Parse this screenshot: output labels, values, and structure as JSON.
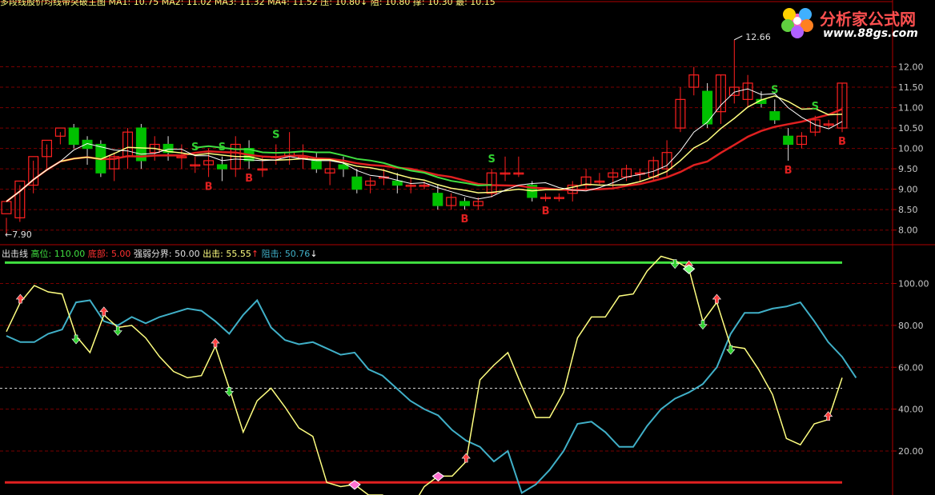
{
  "header": {
    "top_text": "多段线股价均线带突破主图  MA1: 10.75  MA2: 11.02  MA3: 11.32  MA4: 11.52  压: 10.80↓  阻: 10.80  撑: 10.30  最: 10.15"
  },
  "logo": {
    "title": "分析家公式网",
    "url": "www.88gs.com"
  },
  "indicator_legend": {
    "name": "出击线",
    "high_label": "高位:",
    "high_value": "110.00",
    "bottom_label": "底部:",
    "bottom_value": "5.00",
    "mid_label": "强弱分界:",
    "mid_value": "50.00",
    "strike_label": "出击:",
    "strike_value": "55.55",
    "strike_arrow": "↑",
    "resist_label": "阻击:",
    "resist_value": "50.76",
    "resist_arrow": "↓"
  },
  "colors": {
    "background": "#000000",
    "grid": "#7a0000",
    "axis_text": "#c8c8c8",
    "up_candle": "#ff2020",
    "down_candle": "#00c000",
    "ma_white": "#ffffff",
    "ma_red": "#e02020",
    "ma_yellow": "#ffff80",
    "ma_green": "#40e040",
    "strike_line": "#ffff80",
    "resist_line": "#40b0c8",
    "high_line": "#40e040",
    "bottom_line": "#e02020",
    "signal_s": "#30d030",
    "signal_b": "#e02020"
  },
  "chart_data": [
    {
      "type": "candlestick",
      "y_ticks": [
        "12.00",
        "11.50",
        "11.00",
        "10.50",
        "10.00",
        "9.50",
        "9.00",
        "8.50",
        "8.00"
      ],
      "ylim": [
        7.7,
        12.5
      ],
      "max_label": "12.66",
      "min_label": "7.90",
      "candles": [
        [
          8.4,
          8.7,
          7.9,
          8.3
        ],
        [
          8.3,
          9.2,
          8.2,
          9.1
        ],
        [
          9.1,
          9.8,
          8.9,
          9.7
        ],
        [
          9.8,
          10.2,
          9.5,
          10.1
        ],
        [
          10.3,
          10.5,
          10.1,
          10.4
        ],
        [
          10.5,
          10.1,
          10.0,
          10.6
        ],
        [
          10.2,
          10.0,
          9.6,
          10.3
        ],
        [
          10.1,
          9.4,
          9.3,
          10.2
        ],
        [
          9.5,
          9.8,
          9.2,
          9.9
        ],
        [
          9.8,
          10.4,
          9.5,
          10.5
        ],
        [
          10.5,
          9.7,
          9.5,
          10.6
        ],
        [
          9.9,
          10.1,
          9.7,
          10.3
        ],
        [
          10.1,
          9.9,
          9.7,
          10.3
        ],
        [
          9.8,
          9.8,
          9.5,
          10.1
        ],
        [
          9.6,
          9.6,
          9.4,
          9.8
        ],
        [
          9.6,
          9.7,
          9.3,
          10.0
        ],
        [
          9.6,
          9.5,
          9.2,
          9.8
        ],
        [
          9.5,
          10.1,
          9.3,
          10.3
        ],
        [
          10.0,
          9.7,
          9.5,
          10.2
        ],
        [
          9.5,
          9.5,
          9.3,
          9.8
        ],
        [
          9.8,
          9.8,
          9.6,
          10.1
        ],
        [
          9.8,
          9.9,
          9.6,
          10.4
        ],
        [
          9.8,
          9.8,
          9.5,
          10.1
        ],
        [
          9.7,
          9.5,
          9.4,
          9.9
        ],
        [
          9.4,
          9.5,
          9.1,
          9.7
        ],
        [
          9.6,
          9.5,
          9.3,
          9.8
        ],
        [
          9.3,
          9.0,
          8.9,
          9.5
        ],
        [
          9.1,
          9.2,
          8.9,
          9.3
        ],
        [
          9.3,
          9.3,
          9.1,
          9.5
        ],
        [
          9.2,
          9.1,
          8.9,
          9.4
        ],
        [
          9.1,
          9.1,
          8.9,
          9.3
        ],
        [
          9.1,
          9.1,
          9.0,
          9.2
        ],
        [
          8.9,
          8.6,
          8.5,
          9.1
        ],
        [
          8.6,
          8.8,
          8.5,
          8.9
        ],
        [
          8.7,
          8.6,
          8.5,
          8.8
        ],
        [
          8.6,
          8.7,
          8.5,
          8.8
        ],
        [
          8.9,
          9.4,
          8.8,
          9.5
        ],
        [
          9.4,
          9.4,
          9.2,
          9.8
        ],
        [
          9.4,
          9.4,
          9.3,
          9.8
        ],
        [
          9.1,
          8.8,
          8.7,
          9.2
        ],
        [
          8.8,
          8.8,
          8.7,
          8.9
        ],
        [
          8.8,
          8.8,
          8.7,
          8.9
        ],
        [
          8.9,
          9.1,
          8.7,
          9.2
        ],
        [
          9.1,
          9.3,
          9.0,
          9.5
        ],
        [
          9.2,
          9.2,
          9.1,
          9.4
        ],
        [
          9.3,
          9.4,
          9.0,
          9.5
        ],
        [
          9.3,
          9.5,
          9.2,
          9.6
        ],
        [
          9.4,
          9.4,
          9.2,
          9.5
        ],
        [
          9.3,
          9.7,
          9.2,
          9.8
        ],
        [
          9.5,
          9.9,
          9.3,
          10.2
        ],
        [
          10.5,
          11.2,
          10.4,
          11.5
        ],
        [
          11.5,
          11.8,
          11.3,
          12.0
        ],
        [
          11.4,
          10.6,
          10.5,
          11.6
        ],
        [
          10.9,
          11.8,
          10.6,
          11.8
        ],
        [
          11.3,
          11.5,
          11.1,
          12.66
        ],
        [
          11.2,
          11.6,
          11.0,
          11.8
        ],
        [
          11.2,
          11.1,
          11.0,
          11.4
        ],
        [
          10.9,
          10.7,
          10.6,
          11.2
        ],
        [
          10.3,
          10.1,
          9.7,
          10.5
        ],
        [
          10.1,
          10.3,
          10.0,
          10.4
        ],
        [
          10.4,
          10.7,
          10.3,
          10.8
        ],
        [
          10.6,
          10.6,
          10.5,
          10.7
        ],
        [
          10.5,
          11.6,
          10.4,
          11.6
        ]
      ],
      "signals": [
        {
          "i": 14,
          "text": "S"
        },
        {
          "i": 16,
          "text": "S"
        },
        {
          "i": 20,
          "text": "S"
        },
        {
          "i": 15,
          "text": "B"
        },
        {
          "i": 18,
          "text": "B"
        },
        {
          "i": 36,
          "text": "S"
        },
        {
          "i": 34,
          "text": "B"
        },
        {
          "i": 40,
          "text": "B"
        },
        {
          "i": 57,
          "text": "S"
        },
        {
          "i": 60,
          "text": "S"
        },
        {
          "i": 58,
          "text": "B"
        },
        {
          "i": 62,
          "text": "B"
        }
      ]
    },
    {
      "type": "line",
      "y_ticks": [
        "100.00",
        "80.00",
        "60.00",
        "40.00",
        "20.00"
      ],
      "ylim": [
        -1,
        117
      ],
      "high": 110,
      "bottom": 5,
      "midline": 50,
      "series": [
        {
          "name": "出击",
          "values": [
            77,
            91,
            99,
            96,
            95,
            75,
            67,
            85,
            79,
            80,
            74,
            65,
            58,
            55,
            56,
            70,
            50,
            29,
            44,
            50,
            41,
            31,
            27,
            5,
            3,
            4,
            -1,
            -1,
            -5,
            -8,
            3,
            8,
            8,
            15,
            54,
            61,
            67,
            51,
            36,
            36,
            48,
            74,
            84,
            84,
            94,
            95,
            106,
            113,
            111,
            107,
            82,
            91,
            70,
            69,
            59,
            47,
            26,
            23,
            33,
            35,
            55
          ]
        },
        {
          "name": "阻击",
          "values": [
            75,
            72,
            72,
            76,
            78,
            91,
            92,
            82,
            80,
            84,
            81,
            84,
            86,
            88,
            87,
            82,
            76,
            85,
            92,
            79,
            73,
            71,
            72,
            69,
            66,
            67,
            59,
            56,
            50,
            44,
            40,
            37,
            30,
            25,
            22,
            15,
            20,
            0,
            4,
            11,
            20,
            33,
            34,
            29,
            22,
            22,
            32,
            40,
            45,
            48,
            52,
            60,
            76,
            86,
            86,
            88,
            89,
            91,
            82,
            72,
            65,
            55
          ]
        }
      ],
      "markers": [
        {
          "i": 1,
          "kind": "up"
        },
        {
          "i": 5,
          "kind": "down"
        },
        {
          "i": 7,
          "kind": "up"
        },
        {
          "i": 8,
          "kind": "down"
        },
        {
          "i": 15,
          "kind": "up"
        },
        {
          "i": 16,
          "kind": "down"
        },
        {
          "i": 33,
          "kind": "up"
        },
        {
          "i": 48,
          "kind": "down"
        },
        {
          "i": 49,
          "kind": "up"
        },
        {
          "i": 50,
          "kind": "down"
        },
        {
          "i": 51,
          "kind": "up"
        },
        {
          "i": 52,
          "kind": "down"
        },
        {
          "i": 59,
          "kind": "up"
        }
      ],
      "gems": [
        {
          "i": 25,
          "kind": "pink"
        },
        {
          "i": 31,
          "kind": "pink"
        },
        {
          "i": 49,
          "kind": "green"
        }
      ]
    }
  ]
}
